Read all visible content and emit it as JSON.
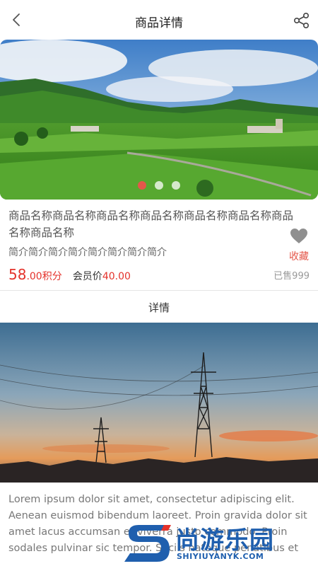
{
  "navbar": {
    "title": "商品详情",
    "back_icon": "chevron-left-icon",
    "share_icon": "share-icon"
  },
  "banner": {
    "slide_count": 3,
    "active_index": 0
  },
  "product": {
    "name": "商品名称商品名称商品名称商品名称商品名称商品名称商品名称商品名称",
    "intro": "简介简介简介简介简介简介简介简介",
    "price_int": "58",
    "price_dec": ".00积分",
    "member_label": "会员价",
    "member_price": "40.00",
    "sold": "已售999",
    "favorite_label": "收藏",
    "favorite_icon": "heart-icon"
  },
  "details": {
    "title": "详情",
    "text": "Lorem ipsum dolor sit amet, consectetur adipiscing elit. Aenean euismod bibendum laoreet. Proin gravida dolor sit amet lacus accumsan et viverra justo commodo. Proin sodales pulvinar sic tempor. Sociis natoque penatibus et"
  },
  "watermark": {
    "cn": "尚游乐园",
    "en": "SHIYIUYANYK.COM"
  },
  "colors": {
    "accent": "#e4574a",
    "price": "#e4322b",
    "watermark": "#1f5fae"
  }
}
